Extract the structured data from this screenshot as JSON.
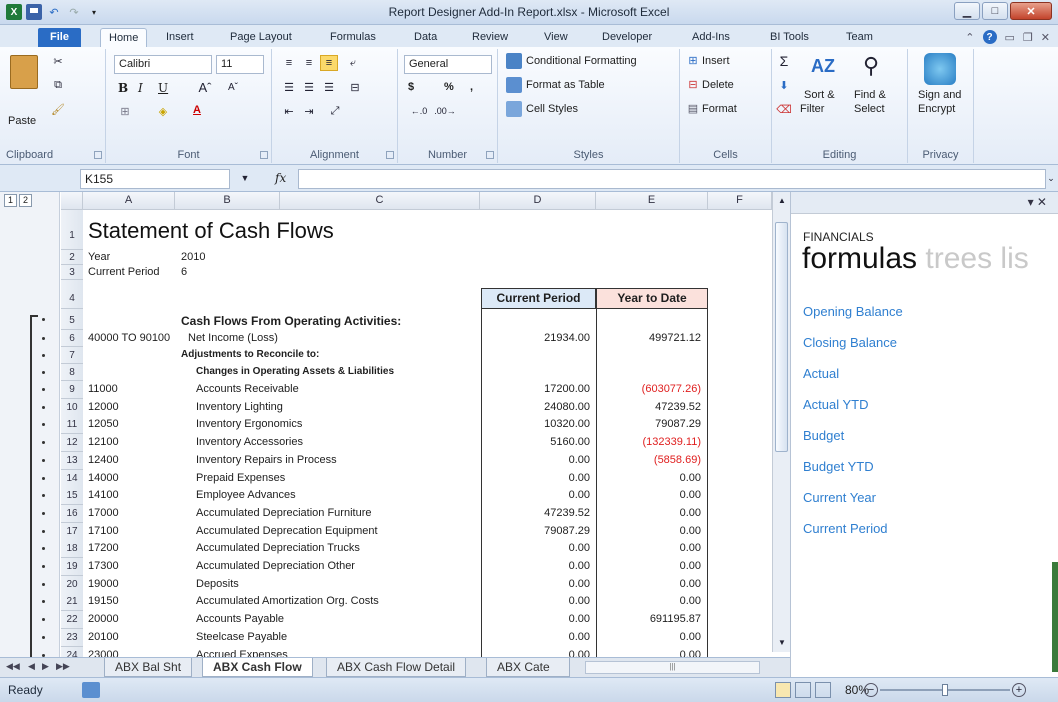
{
  "window": {
    "title": "Report Designer Add-In Report.xlsx - Microsoft Excel"
  },
  "ribbon_tabs": [
    "File",
    "Home",
    "Insert",
    "Page Layout",
    "Formulas",
    "Data",
    "Review",
    "View",
    "Developer",
    "Add-Ins",
    "BI Tools",
    "Team"
  ],
  "ribbon": {
    "clipboard": {
      "label": "Clipboard",
      "paste": "Paste"
    },
    "font": {
      "label": "Font",
      "name": "Calibri",
      "size": "11",
      "bold": "B",
      "italic": "I",
      "underline": "U"
    },
    "alignment": {
      "label": "Alignment"
    },
    "number": {
      "label": "Number",
      "format": "General",
      "currency": "$",
      "percent": "%",
      "comma": ","
    },
    "styles": {
      "label": "Styles",
      "conditional": "Conditional Formatting",
      "format_table": "Format as Table",
      "cell_styles": "Cell Styles"
    },
    "cells": {
      "label": "Cells",
      "insert": "Insert",
      "delete": "Delete",
      "format": "Format"
    },
    "editing": {
      "label": "Editing",
      "sort": "Sort &",
      "filter": "Filter",
      "find": "Find &",
      "select": "Select"
    },
    "privacy": {
      "label": "Privacy",
      "sign": "Sign and",
      "encrypt": "Encrypt"
    }
  },
  "formula_bar": {
    "name_box": "K155",
    "fx": "fx",
    "value": ""
  },
  "columns": [
    "A",
    "B",
    "C",
    "D",
    "E",
    "F"
  ],
  "outline_levels": [
    "1",
    "2"
  ],
  "sheet": {
    "title": "Statement of Cash Flows",
    "year_label": "Year",
    "year_value": "2010",
    "period_label": "Current Period",
    "period_value": "6",
    "hdr_current": "Current Period",
    "hdr_ytd": "Year to Date",
    "section": "Cash Flows From Operating Activities:",
    "net_range": "40000 TO 90100",
    "net_label": "Net Income (Loss)",
    "net_cur": "21934.00",
    "net_ytd": "499721.12",
    "adjust": "Adjustments to Reconcile to:",
    "changes": "Changes in Operating Assets & Liabilities",
    "rows": [
      {
        "r": "9",
        "acct": "11000",
        "desc": "Accounts Receivable",
        "cur": "17200.00",
        "ytd": "(603077.26)",
        "neg": true
      },
      {
        "r": "10",
        "acct": "12000",
        "desc": "Inventory Lighting",
        "cur": "24080.00",
        "ytd": "47239.52",
        "neg": false
      },
      {
        "r": "11",
        "acct": "12050",
        "desc": "Inventory Ergonomics",
        "cur": "10320.00",
        "ytd": "79087.29",
        "neg": false
      },
      {
        "r": "12",
        "acct": "12100",
        "desc": "Inventory Accessories",
        "cur": "5160.00",
        "ytd": "(132339.11)",
        "neg": true
      },
      {
        "r": "13",
        "acct": "12400",
        "desc": "Inventory Repairs in Process",
        "cur": "0.00",
        "ytd": "(5858.69)",
        "neg": true
      },
      {
        "r": "14",
        "acct": "14000",
        "desc": "Prepaid Expenses",
        "cur": "0.00",
        "ytd": "0.00",
        "neg": false
      },
      {
        "r": "15",
        "acct": "14100",
        "desc": "Employee Advances",
        "cur": "0.00",
        "ytd": "0.00",
        "neg": false
      },
      {
        "r": "16",
        "acct": "17000",
        "desc": "Accumulated Depreciation Furniture",
        "cur": "47239.52",
        "ytd": "0.00",
        "neg": false
      },
      {
        "r": "17",
        "acct": "17100",
        "desc": "Accumulated Deprecation Equipment",
        "cur": "79087.29",
        "ytd": "0.00",
        "neg": false
      },
      {
        "r": "18",
        "acct": "17200",
        "desc": "Accumulated Depreciation Trucks",
        "cur": "0.00",
        "ytd": "0.00",
        "neg": false
      },
      {
        "r": "19",
        "acct": "17300",
        "desc": "Accumulated Depreciation Other",
        "cur": "0.00",
        "ytd": "0.00",
        "neg": false
      },
      {
        "r": "20",
        "acct": "19000",
        "desc": "Deposits",
        "cur": "0.00",
        "ytd": "0.00",
        "neg": false
      },
      {
        "r": "21",
        "acct": "19150",
        "desc": "Accumulated Amortization Org. Costs",
        "cur": "0.00",
        "ytd": "0.00",
        "neg": false
      },
      {
        "r": "22",
        "acct": "20000",
        "desc": "Accounts Payable",
        "cur": "0.00",
        "ytd": "691195.87",
        "neg": false
      },
      {
        "r": "23",
        "acct": "20100",
        "desc": "Steelcase Payable",
        "cur": "0.00",
        "ytd": "0.00",
        "neg": false
      },
      {
        "r": "24",
        "acct": "23000",
        "desc": "Accrued Expenses",
        "cur": "0.00",
        "ytd": "0.00",
        "neg": false
      }
    ]
  },
  "sheet_tabs": [
    "ABX Bal Sht",
    "ABX Cash Flow",
    "ABX Cash Flow Detail",
    "ABX Cate"
  ],
  "status": {
    "ready": "Ready",
    "zoom": "80%",
    "zoom_level": 0.5
  },
  "pane": {
    "category": "FINANCIALS",
    "headline": "formulas",
    "headline_next": "trees lis",
    "items": [
      "Opening Balance",
      "Closing Balance",
      "Actual",
      "Actual YTD",
      "Budget",
      "Budget YTD",
      "Current Year",
      "Current Period"
    ]
  },
  "colors": {
    "accent": "#2a6cc5",
    "link": "#2f7fd0",
    "negative": "#e02020",
    "ytd_header": "#fbe1dc",
    "current_header": "#dce9f7"
  }
}
